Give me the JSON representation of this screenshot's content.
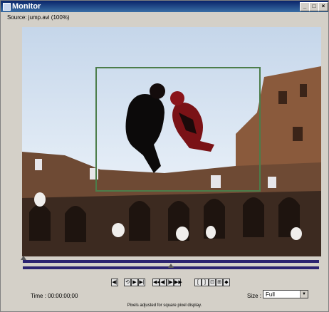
{
  "window": {
    "title": "Monitor"
  },
  "titlebar_buttons": [
    "_",
    "□",
    "×"
  ],
  "source": {
    "text": "Source: jump.avi  (100%)"
  },
  "playback": {
    "position_fraction": 0.5
  },
  "controls": {
    "buttons": [
      "◀|",
      "⟲",
      "▶",
      "▶|",
      "◀◀",
      "◀|",
      "|▶",
      "▶▶",
      "[",
      "]",
      "⊡",
      "⊞",
      "◆"
    ]
  },
  "time": {
    "text": "Time :  00:00:00;00"
  },
  "size": {
    "label": "Size :",
    "value": "Full"
  },
  "note": "Pixels adjusted for square pixel display."
}
